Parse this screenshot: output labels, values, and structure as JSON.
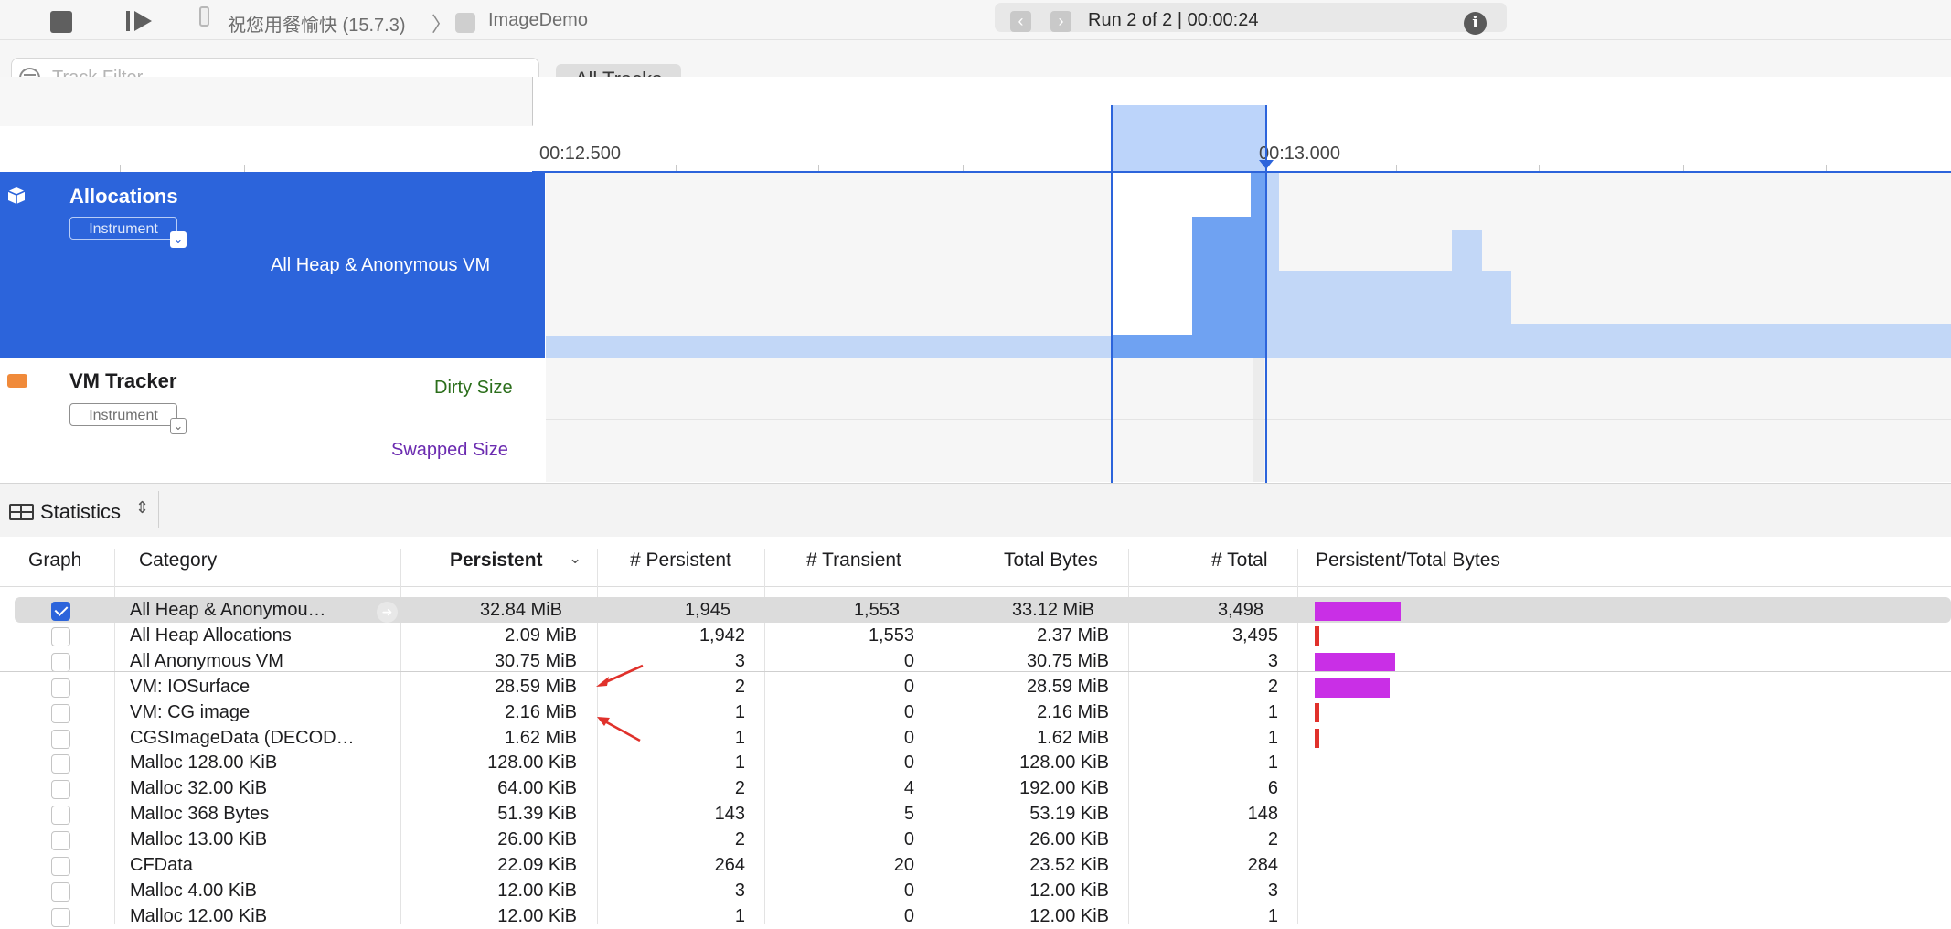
{
  "toolbar": {
    "device": "祝您用餐愉快 (15.7.3)",
    "crumb_separator": "〉",
    "app": "ImageDemo",
    "run_label": "Run 2 of 2  |  00:00:24",
    "prev_arrow": "‹",
    "next_arrow": "›",
    "info_glyph": "i"
  },
  "filter": {
    "placeholder": "Track Filter",
    "all_tracks": "All Tracks"
  },
  "timeline": {
    "ticks": [
      "00:12.500",
      "00:13.000"
    ]
  },
  "tracks": [
    {
      "name": "Allocations",
      "badge": "Instrument",
      "subtitle": "All Heap & Anonymous VM"
    },
    {
      "name": "VM Tracker",
      "badge": "Instrument",
      "dirty": "Dirty Size",
      "swapped": "Swapped Size"
    }
  ],
  "stats": {
    "label": "Statistics",
    "chevron": "⌃⌄"
  },
  "table": {
    "headers": {
      "graph": "Graph",
      "category": "Category",
      "persistent": "Persistent",
      "n_persistent": "# Persistent",
      "n_transient": "# Transient",
      "total_bytes": "Total Bytes",
      "n_total": "# Total",
      "ratio": "Persistent/Total Bytes"
    },
    "rows": [
      {
        "checked": true,
        "category": "All Heap & Anonymou…",
        "persistent": "32.84 MiB",
        "n_persistent": "1,945",
        "n_transient": "1,553",
        "total_bytes": "33.12 MiB",
        "n_total": "3,498",
        "ratio_bar": 0.99,
        "bar_kind": "purple"
      },
      {
        "checked": false,
        "category": "All Heap Allocations",
        "persistent": "2.09 MiB",
        "n_persistent": "1,942",
        "n_transient": "1,553",
        "total_bytes": "2.37 MiB",
        "n_total": "3,495",
        "ratio_bar": 0.06,
        "bar_kind": "red"
      },
      {
        "checked": false,
        "category": "All Anonymous VM",
        "persistent": "30.75 MiB",
        "n_persistent": "3",
        "n_transient": "0",
        "total_bytes": "30.75 MiB",
        "n_total": "3",
        "ratio_bar": 0.93,
        "bar_kind": "purple"
      },
      {
        "checked": false,
        "category": "VM: IOSurface",
        "persistent": "28.59 MiB",
        "n_persistent": "2",
        "n_transient": "0",
        "total_bytes": "28.59 MiB",
        "n_total": "2",
        "ratio_bar": 0.86,
        "bar_kind": "purple"
      },
      {
        "checked": false,
        "category": "VM: CG image",
        "persistent": "2.16 MiB",
        "n_persistent": "1",
        "n_transient": "0",
        "total_bytes": "2.16 MiB",
        "n_total": "1",
        "ratio_bar": 0.07,
        "bar_kind": "red"
      },
      {
        "checked": false,
        "category": "CGSImageData (DECOD…",
        "persistent": "1.62 MiB",
        "n_persistent": "1",
        "n_transient": "0",
        "total_bytes": "1.62 MiB",
        "n_total": "1",
        "ratio_bar": 0.05,
        "bar_kind": "red"
      },
      {
        "checked": false,
        "category": "Malloc 128.00 KiB",
        "persistent": "128.00 KiB",
        "n_persistent": "1",
        "n_transient": "0",
        "total_bytes": "128.00 KiB",
        "n_total": "1",
        "ratio_bar": 0,
        "bar_kind": "none"
      },
      {
        "checked": false,
        "category": "Malloc 32.00 KiB",
        "persistent": "64.00 KiB",
        "n_persistent": "2",
        "n_transient": "4",
        "total_bytes": "192.00 KiB",
        "n_total": "6",
        "ratio_bar": 0,
        "bar_kind": "none"
      },
      {
        "checked": false,
        "category": "Malloc 368 Bytes",
        "persistent": "51.39 KiB",
        "n_persistent": "143",
        "n_transient": "5",
        "total_bytes": "53.19 KiB",
        "n_total": "148",
        "ratio_bar": 0,
        "bar_kind": "none"
      },
      {
        "checked": false,
        "category": "Malloc 13.00 KiB",
        "persistent": "26.00 KiB",
        "n_persistent": "2",
        "n_transient": "0",
        "total_bytes": "26.00 KiB",
        "n_total": "2",
        "ratio_bar": 0,
        "bar_kind": "none"
      },
      {
        "checked": false,
        "category": "CFData",
        "persistent": "22.09 KiB",
        "n_persistent": "264",
        "n_transient": "20",
        "total_bytes": "23.52 KiB",
        "n_total": "284",
        "ratio_bar": 0,
        "bar_kind": "none"
      },
      {
        "checked": false,
        "category": "Malloc 4.00 KiB",
        "persistent": "12.00 KiB",
        "n_persistent": "3",
        "n_transient": "0",
        "total_bytes": "12.00 KiB",
        "n_total": "3",
        "ratio_bar": 0,
        "bar_kind": "none"
      },
      {
        "checked": false,
        "category": "Malloc 12.00 KiB",
        "persistent": "12.00 KiB",
        "n_persistent": "1",
        "n_transient": "0",
        "total_bytes": "12.00 KiB",
        "n_total": "1",
        "ratio_bar": 0,
        "bar_kind": "none"
      }
    ]
  },
  "colors": {
    "accent": "#2c64db",
    "bar_purple": "#c92fe6",
    "bar_red": "#e0312b",
    "annotation_arrow": "#e0312b"
  }
}
